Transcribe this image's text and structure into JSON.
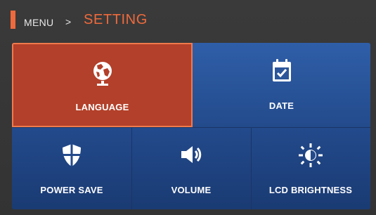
{
  "header": {
    "breadcrumb": "MENU",
    "separator": ">",
    "title": "SETTING",
    "accent_color": "#ee6a3c"
  },
  "menu": {
    "selected": "language",
    "items": [
      {
        "id": "language",
        "label": "LANGUAGE",
        "icon": "globe-icon"
      },
      {
        "id": "date",
        "label": "DATE",
        "icon": "calendar-check-icon"
      },
      {
        "id": "power_save",
        "label": "POWER SAVE",
        "icon": "shield-icon"
      },
      {
        "id": "volume",
        "label": "VOLUME",
        "icon": "speaker-icon"
      },
      {
        "id": "lcd_brightness",
        "label": "LCD BRIGHTNESS",
        "icon": "brightness-icon"
      }
    ]
  },
  "colors": {
    "tile_blue": "#2f5ea8",
    "tile_selected": "#b3402a",
    "background": "#363636"
  }
}
